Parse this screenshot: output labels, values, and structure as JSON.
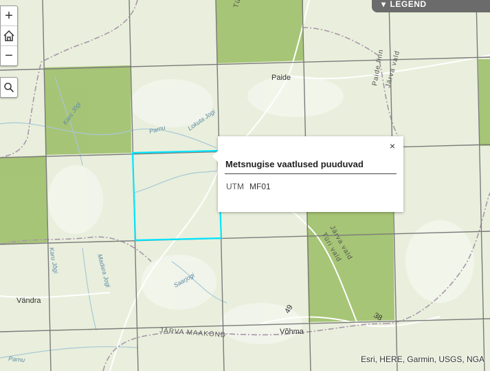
{
  "controls": {
    "zoom_in_label": "+",
    "zoom_out_label": "−"
  },
  "legend": {
    "label": "LEGEND"
  },
  "popup": {
    "title": "Metsnugise vaatlused puuduvad",
    "field_label": "UTM",
    "field_value": "MF01",
    "close_label": "×"
  },
  "attribution": "Esri, HERE, Garmin, USGS, NGA",
  "labels": {
    "paide": "Paide",
    "vandra": "Vändra",
    "vohma": "Võhma",
    "karu_jogi_1": "Karu Jõgi",
    "karu_jogi_2": "Karu Jõgi",
    "parnu_1": "Parnu",
    "parnu_2": "Parnu",
    "lokuta_jogi": "Lokuta Jogi",
    "madara_jogi": "Madara Jogi",
    "saarjogi": "Saarjogi",
    "jarva_maakond": "JÄRVA MAAKOND",
    "jarva_vald_1": "Järva vald",
    "jarva_vald_2": "Järva vald",
    "turi_vald_1": "Türi vald",
    "turi_vald_2": "Türi vald",
    "paide_linn": "Paide linn",
    "road_49": "49",
    "road_38": "38"
  },
  "colors": {
    "base": "#e9efdc",
    "green_cell": "#9fc06a",
    "grid_line": "#7a7a7a",
    "highlight": "#00e5ff",
    "boundary": "#9b8aa3"
  }
}
